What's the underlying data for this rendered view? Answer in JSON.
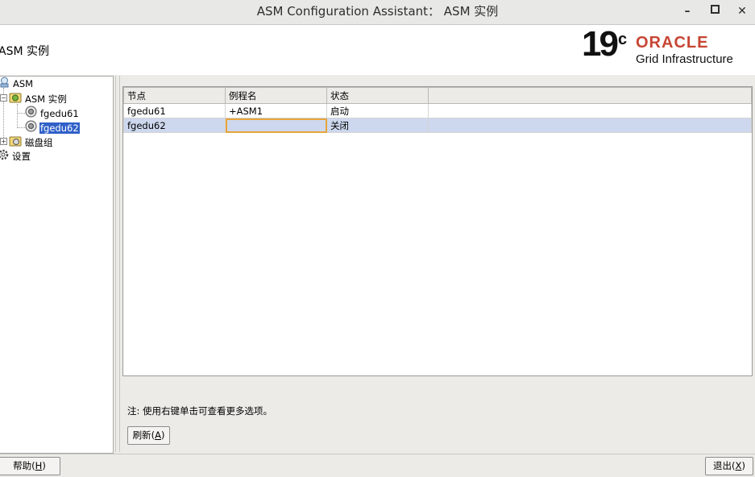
{
  "window": {
    "title": "ASM Configuration Assistant： ASM 实例",
    "minimize": "–",
    "maximize": "□",
    "close": "✕"
  },
  "header": {
    "page_title": "ASM 实例",
    "logo": {
      "version": "19",
      "version_sup": "c",
      "brand": "ORACLE",
      "product": "Grid Infrastructure",
      "brand_color": "#c74634"
    }
  },
  "tree": {
    "root": {
      "label": "ASM",
      "icon": "asm-icon"
    },
    "instances": {
      "label": "ASM 实例",
      "icon": "instances-icon",
      "children": [
        {
          "label": "fgedu61",
          "icon": "instance-icon"
        },
        {
          "label": "fgedu62",
          "icon": "instance-icon",
          "selected": true
        }
      ]
    },
    "diskgroups": {
      "label": "磁盘组",
      "icon": "diskgroup-folder-icon"
    },
    "settings": {
      "label": "设置",
      "icon": "gear-icon"
    }
  },
  "table": {
    "columns": [
      "节点",
      "例程名",
      "状态",
      ""
    ],
    "rows": [
      {
        "node": "fgedu61",
        "instance": "+ASM1",
        "status": "启动"
      },
      {
        "node": "fgedu62",
        "instance": "",
        "status": "关闭"
      }
    ],
    "selected_row_color": "#cdd8ee"
  },
  "note": "注: 使用右键单击可查看更多选项。",
  "buttons": {
    "refresh": {
      "text": "刷新",
      "mnemonic": "A"
    },
    "help": {
      "text": "帮助",
      "mnemonic": "H"
    },
    "exit": {
      "text": "退出",
      "mnemonic": "X"
    }
  }
}
